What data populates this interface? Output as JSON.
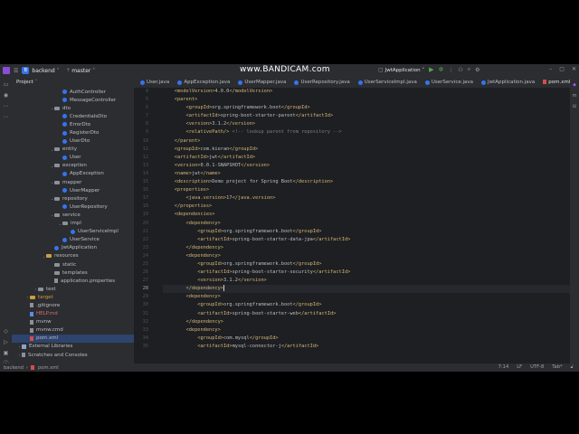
{
  "watermark": "www.BANDICAM.com",
  "titlebar": {
    "project_badge": "B",
    "project_name": "backend",
    "branch": "master",
    "run_config": "JwtApplication"
  },
  "project_panel": {
    "title": "Project",
    "tree": [
      {
        "label": "AuthController",
        "icon": "class",
        "indent": 4
      },
      {
        "label": "MessageController",
        "icon": "class",
        "indent": 4
      },
      {
        "label": "dto",
        "icon": "pkg",
        "indent": 3,
        "arrow": "v"
      },
      {
        "label": "CredentialsDto",
        "icon": "class",
        "indent": 4
      },
      {
        "label": "ErrorDto",
        "icon": "class",
        "indent": 4
      },
      {
        "label": "RegisterDto",
        "icon": "class",
        "indent": 4
      },
      {
        "label": "UserDto",
        "icon": "class",
        "indent": 4
      },
      {
        "label": "entity",
        "icon": "pkg",
        "indent": 3,
        "arrow": "v"
      },
      {
        "label": "User",
        "icon": "class",
        "indent": 4
      },
      {
        "label": "exception",
        "icon": "pkg",
        "indent": 3,
        "arrow": "v"
      },
      {
        "label": "AppException",
        "icon": "class",
        "indent": 4
      },
      {
        "label": "mapper",
        "icon": "pkg",
        "indent": 3,
        "arrow": "v"
      },
      {
        "label": "UserMapper",
        "icon": "class",
        "indent": 4
      },
      {
        "label": "repository",
        "icon": "pkg",
        "indent": 3,
        "arrow": "v"
      },
      {
        "label": "UserRepository",
        "icon": "class",
        "indent": 4
      },
      {
        "label": "service",
        "icon": "pkg",
        "indent": 3,
        "arrow": "v"
      },
      {
        "label": "impl",
        "icon": "pkg",
        "indent": 4,
        "arrow": "v"
      },
      {
        "label": "UserServiceImpl",
        "icon": "class",
        "indent": 5
      },
      {
        "label": "UserService",
        "icon": "class",
        "indent": 4
      },
      {
        "label": "JwtApplication",
        "icon": "class",
        "indent": 3
      },
      {
        "label": "resources",
        "icon": "res",
        "indent": 2,
        "arrow": "v"
      },
      {
        "label": "static",
        "icon": "folder",
        "indent": 3
      },
      {
        "label": "templates",
        "icon": "folder",
        "indent": 3
      },
      {
        "label": "application.properties",
        "icon": "file",
        "indent": 3
      },
      {
        "label": "test",
        "icon": "folder",
        "indent": 1,
        "arrow": ">"
      },
      {
        "label": "target",
        "icon": "target",
        "indent": 0,
        "arrow": ">",
        "color": "orange"
      },
      {
        "label": ".gitignore",
        "icon": "file",
        "indent": 0
      },
      {
        "label": "HELP.md",
        "icon": "md",
        "indent": 0,
        "color": "red"
      },
      {
        "label": "mvnw",
        "icon": "file",
        "indent": 0
      },
      {
        "label": "mvnw.cmd",
        "icon": "file",
        "indent": 0
      },
      {
        "label": "pom.xml",
        "icon": "xml",
        "indent": 0,
        "selected": true
      },
      {
        "label": "External Libraries",
        "icon": "lib",
        "indent": -1,
        "arrow": ">"
      },
      {
        "label": "Scratches and Consoles",
        "icon": "file",
        "indent": -1,
        "arrow": ">"
      }
    ]
  },
  "tabs": [
    {
      "label": "User.java",
      "icon": "class"
    },
    {
      "label": "AppException.java",
      "icon": "class"
    },
    {
      "label": "UserMapper.java",
      "icon": "class"
    },
    {
      "label": "UserRepository.java",
      "icon": "class"
    },
    {
      "label": "UserServiceImpl.java",
      "icon": "class"
    },
    {
      "label": "UserService.java",
      "icon": "class"
    },
    {
      "label": "JwtApplication.java",
      "icon": "class"
    },
    {
      "label": "pom.xml",
      "icon": "xml",
      "active": true
    }
  ],
  "editor": {
    "current_line": 28,
    "lines": [
      {
        "n": 4,
        "indent": 1,
        "parts": [
          [
            "tag",
            "<modelVersion>"
          ],
          [
            "txt",
            "4.0.0"
          ],
          [
            "tag",
            "</modelVersion>"
          ]
        ]
      },
      {
        "n": 5,
        "indent": 1,
        "parts": [
          [
            "tag",
            "<parent>"
          ]
        ]
      },
      {
        "n": 6,
        "indent": 2,
        "parts": [
          [
            "tag",
            "<groupId>"
          ],
          [
            "txt",
            "org.springframework.boot"
          ],
          [
            "tag",
            "</groupId>"
          ]
        ]
      },
      {
        "n": 7,
        "indent": 2,
        "parts": [
          [
            "tag",
            "<artifactId>"
          ],
          [
            "txt",
            "spring-boot-starter-parent"
          ],
          [
            "tag",
            "</artifactId>"
          ]
        ]
      },
      {
        "n": 8,
        "indent": 2,
        "parts": [
          [
            "tag",
            "<version>"
          ],
          [
            "txt",
            "3.1.2"
          ],
          [
            "tag",
            "</version>"
          ]
        ]
      },
      {
        "n": 9,
        "indent": 2,
        "parts": [
          [
            "tag",
            "<relativePath/>"
          ],
          [
            "cmt",
            " <!-- lookup parent from repository -->"
          ]
        ]
      },
      {
        "n": 10,
        "indent": 1,
        "parts": [
          [
            "tag",
            "</parent>"
          ]
        ]
      },
      {
        "n": 11,
        "indent": 1,
        "parts": [
          [
            "tag",
            "<groupId>"
          ],
          [
            "txt",
            "com.kieran"
          ],
          [
            "tag",
            "</groupId>"
          ]
        ]
      },
      {
        "n": 12,
        "indent": 1,
        "parts": [
          [
            "tag",
            "<artifactId>"
          ],
          [
            "txt",
            "jwt"
          ],
          [
            "tag",
            "</artifactId>"
          ]
        ]
      },
      {
        "n": 13,
        "indent": 1,
        "parts": [
          [
            "tag",
            "<version>"
          ],
          [
            "txt",
            "0.0.1-SNAPSHOT"
          ],
          [
            "tag",
            "</version>"
          ]
        ]
      },
      {
        "n": 14,
        "indent": 1,
        "parts": [
          [
            "tag",
            "<name>"
          ],
          [
            "txt",
            "jwt"
          ],
          [
            "tag",
            "</name>"
          ]
        ]
      },
      {
        "n": 15,
        "indent": 1,
        "parts": [
          [
            "tag",
            "<description>"
          ],
          [
            "txt",
            "Demo project for Spring Boot"
          ],
          [
            "tag",
            "</description>"
          ]
        ]
      },
      {
        "n": 16,
        "indent": 1,
        "parts": [
          [
            "tag",
            "<properties>"
          ]
        ]
      },
      {
        "n": 17,
        "indent": 2,
        "parts": [
          [
            "tag",
            "<java.version>"
          ],
          [
            "txt",
            "17"
          ],
          [
            "tag",
            "</java.version>"
          ]
        ]
      },
      {
        "n": 18,
        "indent": 1,
        "parts": [
          [
            "tag",
            "</properties>"
          ]
        ]
      },
      {
        "n": 19,
        "indent": 1,
        "parts": [
          [
            "tag",
            "<dependencies>"
          ]
        ]
      },
      {
        "n": 20,
        "indent": 2,
        "parts": [
          [
            "tag",
            "<dependency>"
          ]
        ]
      },
      {
        "n": 21,
        "indent": 3,
        "parts": [
          [
            "tag",
            "<groupId>"
          ],
          [
            "txt",
            "org.springframework.boot"
          ],
          [
            "tag",
            "</groupId>"
          ]
        ]
      },
      {
        "n": 22,
        "indent": 3,
        "parts": [
          [
            "tag",
            "<artifactId>"
          ],
          [
            "txt",
            "spring-boot-starter-data-jpa"
          ],
          [
            "tag",
            "</artifactId>"
          ]
        ]
      },
      {
        "n": 23,
        "indent": 2,
        "parts": [
          [
            "tag",
            "</dependency>"
          ]
        ]
      },
      {
        "n": 24,
        "indent": 2,
        "parts": [
          [
            "tag",
            "<dependency>"
          ]
        ]
      },
      {
        "n": 25,
        "indent": 3,
        "parts": [
          [
            "tag",
            "<groupId>"
          ],
          [
            "txt",
            "org.springframework.boot"
          ],
          [
            "tag",
            "</groupId>"
          ]
        ]
      },
      {
        "n": 26,
        "indent": 3,
        "parts": [
          [
            "tag",
            "<artifactId>"
          ],
          [
            "txt",
            "spring-boot-starter-security"
          ],
          [
            "tag",
            "</artifactId>"
          ]
        ]
      },
      {
        "n": 27,
        "indent": 3,
        "parts": [
          [
            "tag",
            "<version>"
          ],
          [
            "txt",
            "3.1.2"
          ],
          [
            "tag",
            "</version>"
          ]
        ]
      },
      {
        "n": 28,
        "indent": 2,
        "parts": [
          [
            "tag",
            "</dependency>"
          ]
        ]
      },
      {
        "n": 29,
        "indent": 2,
        "parts": [
          [
            "tag",
            "<dependency>"
          ]
        ]
      },
      {
        "n": 30,
        "indent": 3,
        "parts": [
          [
            "tag",
            "<groupId>"
          ],
          [
            "txt",
            "org.springframework.boot"
          ],
          [
            "tag",
            "</groupId>"
          ]
        ]
      },
      {
        "n": 31,
        "indent": 3,
        "parts": [
          [
            "tag",
            "<artifactId>"
          ],
          [
            "txt",
            "spring-boot-starter-web"
          ],
          [
            "tag",
            "</artifactId>"
          ]
        ]
      },
      {
        "n": 32,
        "indent": 2,
        "parts": [
          [
            "tag",
            "</dependency>"
          ]
        ]
      },
      {
        "n": 33,
        "indent": 2,
        "parts": [
          [
            "tag",
            "<dependency>"
          ]
        ]
      },
      {
        "n": 34,
        "indent": 3,
        "parts": [
          [
            "tag",
            "<groupId>"
          ],
          [
            "txt",
            "com.mysql"
          ],
          [
            "tag",
            "</groupId>"
          ]
        ]
      },
      {
        "n": 35,
        "indent": 3,
        "parts": [
          [
            "tag",
            "<artifactId>"
          ],
          [
            "txt",
            "mysql-connector-j"
          ],
          [
            "tag",
            "</artifactId>"
          ]
        ]
      }
    ]
  },
  "statusbar": {
    "crumb_project": "backend",
    "crumb_file": "pom.xml",
    "position": "7:14",
    "line_ending": "LF",
    "encoding": "UTF-8",
    "indent": "Tab*"
  },
  "colors": {
    "accent": "#3574f0",
    "tag": "#d5b778",
    "comment": "#7a7e85"
  }
}
